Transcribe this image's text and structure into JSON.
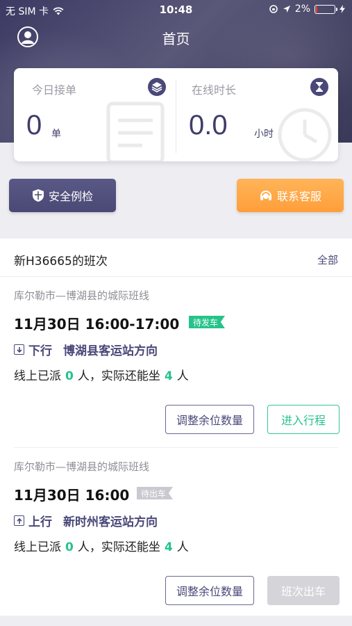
{
  "status_bar": {
    "carrier": "无 SIM 卡",
    "time": "10:48",
    "battery": "2%"
  },
  "nav": {
    "title": "首页"
  },
  "stats": {
    "today_orders": {
      "label": "今日接单",
      "value": "0",
      "unit": "单"
    },
    "online_time": {
      "label": "在线时长",
      "value": "0.0",
      "unit": "小时"
    }
  },
  "actions": {
    "safety_check": "安全例检",
    "contact_service": "联系客服"
  },
  "trips_section": {
    "title": "新H36665的班次",
    "all_link": "全部"
  },
  "trips": [
    {
      "route": "库尔勒市—博湖县的城际班线",
      "datetime": "11月30日 16:00-17:00",
      "status": "待发车",
      "direction": "下行",
      "destination": "博湖县客运站方向",
      "seats_prefix": "线上已派",
      "dispatched": "0",
      "seats_mid": "人，实际还能坐",
      "available": "4",
      "seats_suffix": "人",
      "btn_adjust": "调整余位数量",
      "btn_primary": "进入行程"
    },
    {
      "route": "库尔勒市—博湖县的城际班线",
      "datetime": "11月30日 16:00",
      "status": "待出车",
      "direction": "上行",
      "destination": "新时州客运站方向",
      "seats_prefix": "线上已派",
      "dispatched": "0",
      "seats_mid": "人，实际还能坐",
      "available": "4",
      "seats_suffix": "人",
      "btn_adjust": "调整余位数量",
      "btn_primary": "班次出车"
    }
  ],
  "colors": {
    "primary": "#4a4878",
    "accent_orange": "#ff9e3a",
    "accent_green": "#25c38a",
    "disabled": "#d4d4d9"
  }
}
